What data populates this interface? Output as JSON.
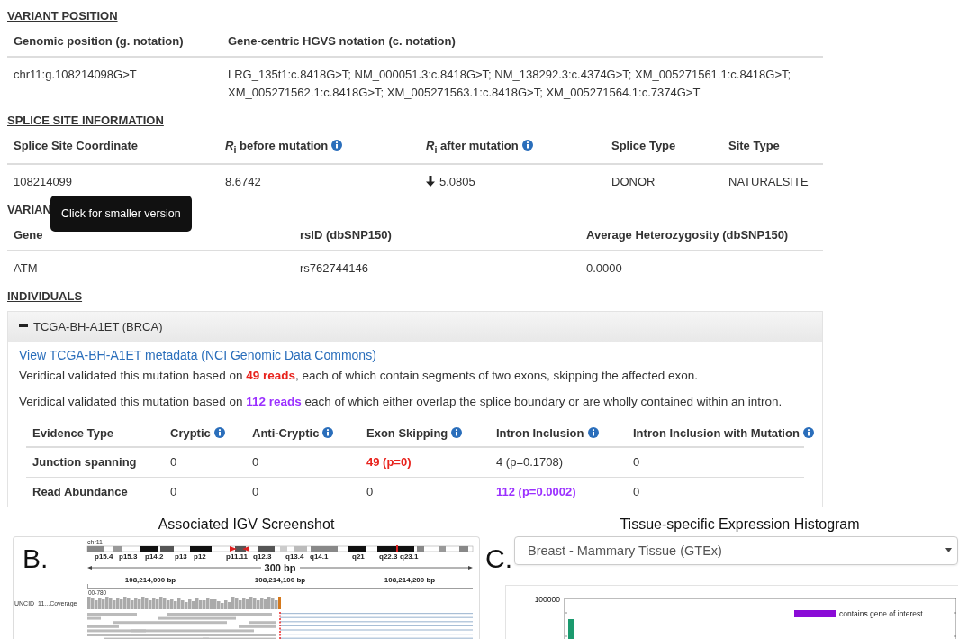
{
  "variant_position": {
    "heading": "VARIANT POSITION",
    "columns": [
      {
        "label": "Genomic position (g. notation)",
        "info": false
      },
      {
        "label": "Gene-centric HGVS notation (c. notation)",
        "info": false
      }
    ],
    "rows": [
      [
        "chr11:g.108214098G>T",
        "LRG_135t1:c.8418G>T; NM_000051.3:c.8418G>T; NM_138292.3:c.4374G>T; XM_005271561.1:c.8418G>T; XM_005271562.1:c.8418G>T; XM_005271563.1:c.8418G>T; XM_005271564.1:c.7374G>T"
      ]
    ]
  },
  "splice_site": {
    "heading": "SPLICE SITE INFORMATION",
    "columns": [
      {
        "label": "Splice Site Coordinate",
        "info": false
      },
      {
        "label": "*R*$_{i}$ before mutation",
        "info": true
      },
      {
        "label": "*R*$_{i}$ after mutation",
        "info": true
      },
      {
        "label": "Splice Type",
        "info": false
      },
      {
        "label": "Site Type",
        "info": false
      }
    ],
    "rows": [
      [
        "108214099",
        "8.6742",
        {
          "text": "5.0805",
          "kind": "decrease"
        },
        "DONOR",
        "NATURALSITE"
      ]
    ]
  },
  "variant_data": {
    "heading": "VARIAN",
    "columns": [
      {
        "label": "Gene",
        "info": false
      },
      {
        "label": "rsID (dbSNP150)",
        "info": false
      },
      {
        "label": "Average  Heterozygosity  (dbSNP150)",
        "info": false
      }
    ],
    "rows": [
      [
        "ATM",
        "rs762744146",
        "0.0000"
      ]
    ],
    "tooltip": "Click for smaller version"
  },
  "individuals": {
    "heading": "INDIVIDUALS",
    "panel": {
      "title": "TCGA-BH-A1ET (BRCA)",
      "expanded": true,
      "link": "View TCGA-BH-A1ET metadata (NCI Genomic Data Commons)",
      "sentences": [
        {
          "before": "Veridical validated this mutation based on ",
          "highlight": "49 reads",
          "color": "#e8231d",
          "after": ", each of which contain segments of two exons, skipping the affected exon."
        },
        {
          "before": "Veridical validated this mutation based on ",
          "highlight": "112 reads",
          "color": "#9b30ff",
          "after": " each of which either overlap the splice boundary or are wholly contained within an intron."
        }
      ],
      "evidence": {
        "columns": [
          {
            "label": "Evidence Type",
            "info": false
          },
          {
            "label": "Cryptic",
            "info": true
          },
          {
            "label": "Anti-Cryptic",
            "info": true
          },
          {
            "label": "Exon Skipping",
            "info": true
          },
          {
            "label": "Intron Inclusion",
            "info": true
          },
          {
            "label": "Intron Inclusion with Mutation",
            "info": true
          }
        ],
        "rows": [
          [
            "Junction spanning",
            "0",
            "0",
            {
              "text": "49 (p=0)",
              "color": "#e8231d"
            },
            "4 (p=0.1708)",
            "0"
          ],
          [
            "Read Abundance",
            "0",
            "0",
            "0",
            {
              "text": "112 (p=0.0002)",
              "color": "#9b30ff"
            },
            "0"
          ]
        ]
      }
    }
  },
  "figure_b": {
    "label": "B.",
    "title": "Associated IGV Screenshot",
    "chromosome": "chr11",
    "bands": [
      "p15.4",
      "p15.3",
      "p14.2",
      "p13",
      "p12",
      "p11.11",
      "q12.3",
      "q13.4",
      "q14.1",
      "q21",
      "q22.3",
      "q23.1"
    ],
    "span": "300 bp",
    "positions": [
      "108,214,000 bp",
      "108,214,100 bp",
      "108,214,200 bp"
    ],
    "track": "UNCID_11...Coverage",
    "range": "00-780"
  },
  "figure_c": {
    "label": "C.",
    "title": "Tissue-specific Expression Histogram",
    "tissue": "Breast - Mammary Tissue (GTEx)",
    "y_tick": "100000",
    "legend": "contains gene of interest"
  }
}
